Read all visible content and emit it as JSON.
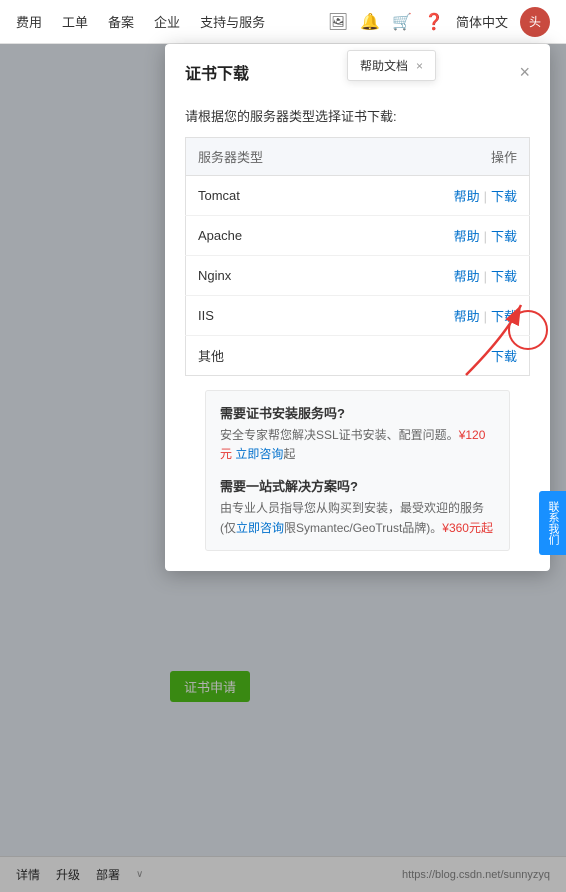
{
  "topnav": {
    "items": [
      "费用",
      "工单",
      "备案",
      "企业",
      "支持与服务"
    ],
    "lang": "简体中文",
    "icons": [
      "image-icon",
      "bell-icon",
      "cart-icon",
      "help-icon"
    ]
  },
  "help_tooltip": {
    "label": "帮助文档",
    "close": "×"
  },
  "modal": {
    "title": "证书下载",
    "close": "×",
    "instruction": "请根据您的服务器类型选择证书下载:",
    "table": {
      "col_type": "服务器类型",
      "col_action": "操作",
      "rows": [
        {
          "type": "Tomcat",
          "help": "帮助",
          "download": "下载"
        },
        {
          "type": "Apache",
          "help": "帮助",
          "download": "下载"
        },
        {
          "type": "Nginx",
          "help": "帮助",
          "download": "下载"
        },
        {
          "type": "IIS",
          "help": "帮助",
          "download": "下载"
        },
        {
          "type": "其他",
          "help": null,
          "download": "下载"
        }
      ]
    },
    "promo": [
      {
        "title": "需要证书安装服务吗?",
        "desc_before": "安全专家帮您解决SSL证书安装、配置问题。",
        "price": "¥120元",
        "link": "立即咨询",
        "desc_after": "起"
      },
      {
        "title": "需要一站式解决方案吗?",
        "desc_before": "由专业人员指导您从购买到安装，最受欢迎的服务(仅",
        "price": "¥360元",
        "link": "立即咨询",
        "desc_after": "限Symantec/GeoTrust品牌)。",
        "price2": "¥360元起"
      }
    ]
  },
  "cert_apply_btn": "证书申请",
  "bottomnav": {
    "items": [
      "详情",
      "升级",
      "部署"
    ],
    "arrow": "∨",
    "url": "https://blog.csdn.net/sunnyzyq"
  },
  "float_cta": "联系我们",
  "annotation": {
    "circle_target": "Nginx下载按钮"
  }
}
